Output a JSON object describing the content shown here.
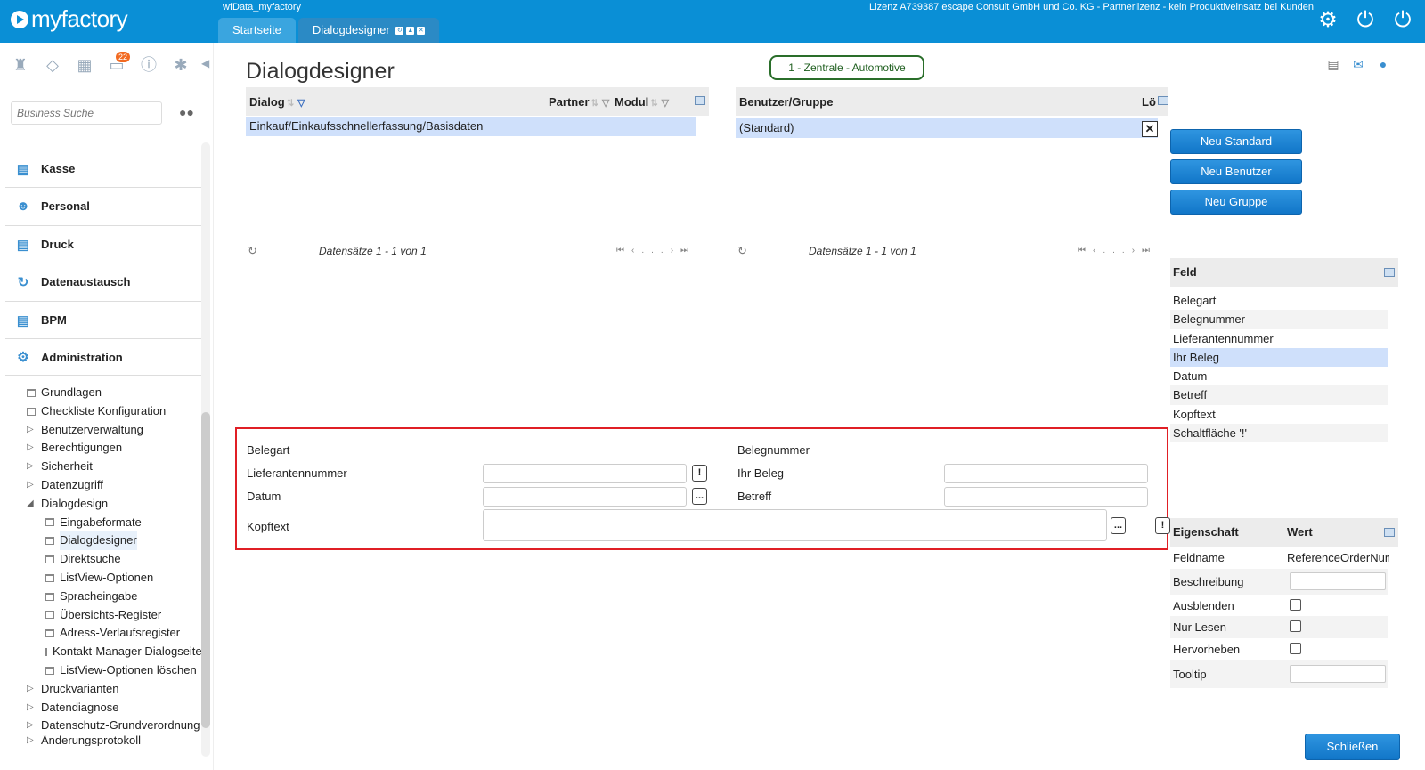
{
  "app": {
    "logo": "myfactory",
    "window_title": "wfData_myfactory",
    "license": "Lizenz A739387 escape Consult GmbH und Co. KG - Partnerlizenz - kein Produktiveinsatz bei Kunden",
    "tabs": [
      {
        "label": "Startseite"
      },
      {
        "label": "Dialogdesigner"
      }
    ]
  },
  "sidebar": {
    "notification_count": "22",
    "search_placeholder": "Business Suche",
    "modules": [
      {
        "label": "Kasse"
      },
      {
        "label": "Personal"
      },
      {
        "label": "Druck"
      },
      {
        "label": "Datenaustausch"
      },
      {
        "label": "BPM"
      },
      {
        "label": "Administration"
      }
    ],
    "tree": [
      {
        "label": "Grundlagen"
      },
      {
        "label": "Checkliste Konfiguration"
      },
      {
        "label": "Benutzerverwaltung"
      },
      {
        "label": "Berechtigungen"
      },
      {
        "label": "Sicherheit"
      },
      {
        "label": "Datenzugriff"
      },
      {
        "label": "Dialogdesign"
      },
      {
        "label": "Eingabeformate"
      },
      {
        "label": "Dialogdesigner"
      },
      {
        "label": "Direktsuche"
      },
      {
        "label": "ListView-Optionen"
      },
      {
        "label": "Spracheingabe"
      },
      {
        "label": "Übersichts-Register"
      },
      {
        "label": "Adress-Verlaufsregister"
      },
      {
        "label": "Kontakt-Manager Dialogseite"
      },
      {
        "label": "ListView-Optionen löschen"
      },
      {
        "label": "Druckvarianten"
      },
      {
        "label": "Datendiagnose"
      },
      {
        "label": "Datenschutz-Grundverordnung"
      },
      {
        "label": "Änderungsprotokoll"
      }
    ]
  },
  "main": {
    "title": "Dialogdesigner",
    "company": "1 - Zentrale - Automotive",
    "dialog_grid": {
      "col_dialog": "Dialog",
      "col_partner": "Partner",
      "col_modul": "Modul",
      "row": "Einkauf/Einkaufsschnellerfassung/Basisdaten",
      "pager": "Datensätze 1 - 1 von 1",
      "ellipsis": "..."
    },
    "user_grid": {
      "col_user": "Benutzer/Gruppe",
      "col_delete": "Lö",
      "row": "(Standard)",
      "pager": "Datensätze 1 - 1 von 1",
      "ellipsis": "..."
    },
    "buttons": {
      "new_standard": "Neu Standard",
      "new_user": "Neu Benutzer",
      "new_group": "Neu Gruppe",
      "close": "Schließen"
    },
    "field_panel": {
      "header": "Feld",
      "items": [
        {
          "label": "Belegart"
        },
        {
          "label": "Belegnummer"
        },
        {
          "label": "Lieferantennummer"
        },
        {
          "label": "Ihr Beleg"
        },
        {
          "label": "Datum"
        },
        {
          "label": "Betreff"
        },
        {
          "label": "Kopftext"
        },
        {
          "label": "Schaltfläche '!'"
        }
      ]
    },
    "property_panel": {
      "col_property": "Eigenschaft",
      "col_value": "Wert",
      "rows": [
        {
          "key": "Feldname",
          "value": "ReferenceOrderNumber"
        },
        {
          "key": "Beschreibung"
        },
        {
          "key": "Ausblenden"
        },
        {
          "key": "Nur Lesen"
        },
        {
          "key": "Hervorheben"
        },
        {
          "key": "Tooltip"
        }
      ]
    },
    "preview": {
      "belegart": "Belegart",
      "belegnummer": "Belegnummer",
      "lieferantennummer": "Lieferantennummer",
      "ihr_beleg": "Ihr Beleg",
      "datum": "Datum",
      "betreff": "Betreff",
      "kopftext": "Kopftext",
      "bang": "!",
      "dots": "..."
    }
  },
  "colors": {
    "brand": "#0a8fd6",
    "selection": "#cfe0fb",
    "highlight_border": "#e01f25",
    "company_border": "#2a6e2a"
  }
}
